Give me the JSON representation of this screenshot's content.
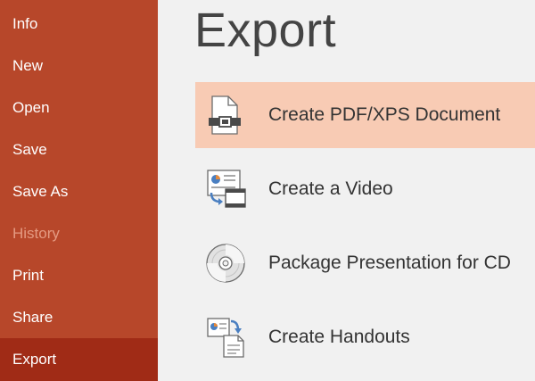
{
  "sidebar": {
    "items": [
      {
        "label": "Info",
        "state": "normal"
      },
      {
        "label": "New",
        "state": "normal"
      },
      {
        "label": "Open",
        "state": "normal"
      },
      {
        "label": "Save",
        "state": "normal"
      },
      {
        "label": "Save As",
        "state": "normal"
      },
      {
        "label": "History",
        "state": "disabled"
      },
      {
        "label": "Print",
        "state": "normal"
      },
      {
        "label": "Share",
        "state": "normal"
      },
      {
        "label": "Export",
        "state": "active"
      }
    ]
  },
  "main": {
    "title": "Export",
    "options": [
      {
        "label": "Create PDF/XPS Document",
        "icon": "pdf-xps-document-icon",
        "selected": true
      },
      {
        "label": "Create a Video",
        "icon": "video-icon",
        "selected": false
      },
      {
        "label": "Package Presentation for CD",
        "icon": "cd-icon",
        "selected": false
      },
      {
        "label": "Create Handouts",
        "icon": "handouts-icon",
        "selected": false
      }
    ]
  },
  "colors": {
    "sidebar_bg": "#b7472a",
    "sidebar_active": "#a02b16",
    "sidebar_disabled_text": "#e49a82",
    "selected_option_bg": "#f8cbb4",
    "main_bg": "#f1f1f1"
  }
}
